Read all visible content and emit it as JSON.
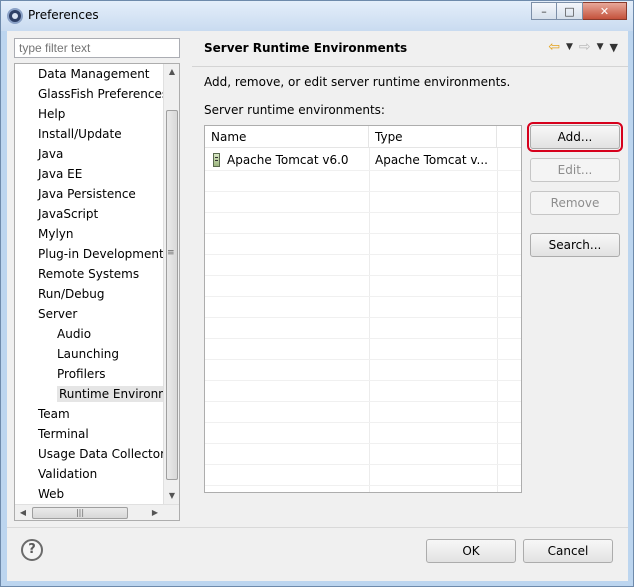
{
  "window": {
    "title": "Preferences",
    "minimize_glyph": "–",
    "maximize_glyph": "□",
    "close_glyph": "✕"
  },
  "sidebar": {
    "filter_placeholder": "type filter text",
    "items": [
      {
        "label": "Data Management",
        "level": 0
      },
      {
        "label": "GlassFish Preferences",
        "level": 0
      },
      {
        "label": "Help",
        "level": 0
      },
      {
        "label": "Install/Update",
        "level": 0
      },
      {
        "label": "Java",
        "level": 0
      },
      {
        "label": "Java EE",
        "level": 0
      },
      {
        "label": "Java Persistence",
        "level": 0
      },
      {
        "label": "JavaScript",
        "level": 0
      },
      {
        "label": "Mylyn",
        "level": 0
      },
      {
        "label": "Plug-in Development",
        "level": 0
      },
      {
        "label": "Remote Systems",
        "level": 0
      },
      {
        "label": "Run/Debug",
        "level": 0
      },
      {
        "label": "Server",
        "level": 0
      },
      {
        "label": "Audio",
        "level": 1
      },
      {
        "label": "Launching",
        "level": 1
      },
      {
        "label": "Profilers",
        "level": 1
      },
      {
        "label": "Runtime Environm",
        "level": 1,
        "selected": true
      },
      {
        "label": "Team",
        "level": 0
      },
      {
        "label": "Terminal",
        "level": 0
      },
      {
        "label": "Usage Data Collector",
        "level": 0
      },
      {
        "label": "Validation",
        "level": 0
      },
      {
        "label": "Web",
        "level": 0
      }
    ]
  },
  "page": {
    "title": "Server Runtime Environments",
    "description": "Add, remove, or edit server runtime environments.",
    "list_label": "Server runtime environments:",
    "table": {
      "columns": [
        "Name",
        "Type"
      ],
      "rows": [
        {
          "name": "Apache Tomcat v6.0",
          "type": "Apache Tomcat v...",
          "icon": "server-runtime-icon"
        }
      ]
    },
    "buttons": {
      "add": "Add...",
      "edit": "Edit...",
      "remove": "Remove",
      "search": "Search..."
    }
  },
  "footer": {
    "help_glyph": "?",
    "ok": "OK",
    "cancel": "Cancel"
  },
  "colors": {
    "highlight_outline": "#d6001c",
    "back_arrow": "#e3a11a"
  }
}
